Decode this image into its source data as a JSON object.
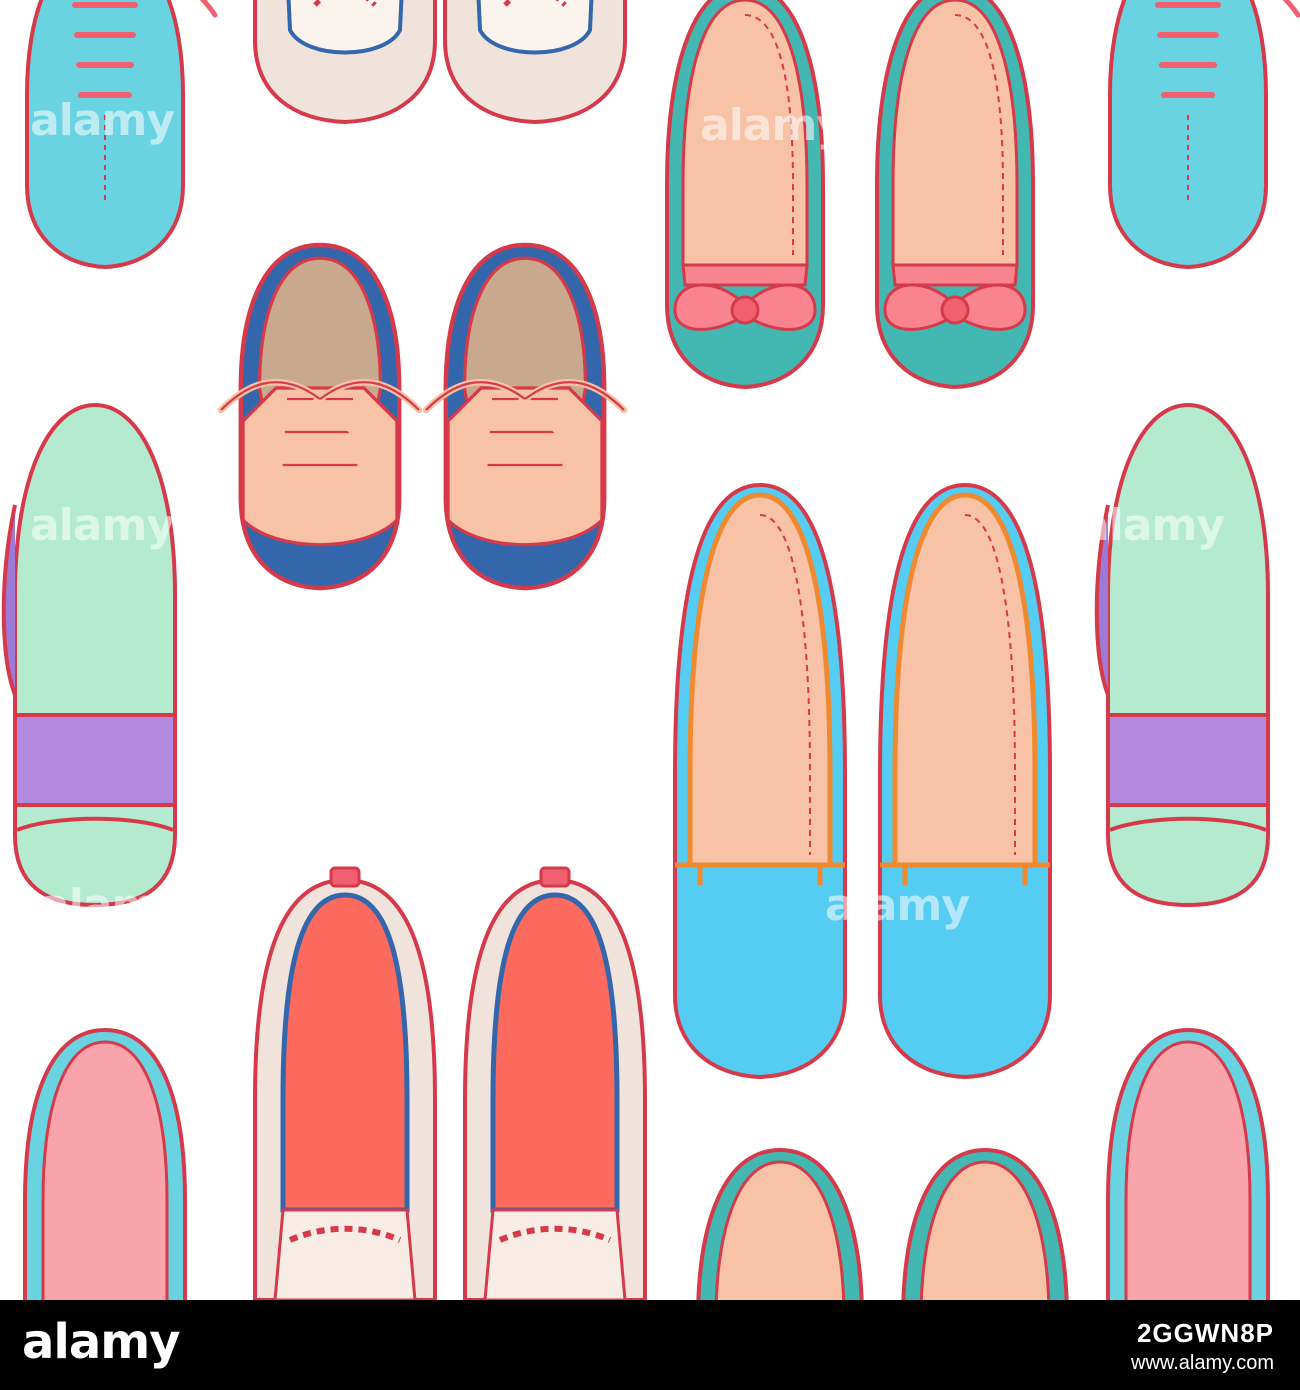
{
  "watermark": "alamy",
  "footer": {
    "brand": "alamy",
    "image_id": "2GGWN8P",
    "site": "www.alamy.com"
  },
  "palette": {
    "outline": "#d63a4a",
    "turquoise": "#6ad3e2",
    "teal": "#43b8b2",
    "navy": "#3366aa",
    "peach": "#f7c2a6",
    "coral": "#fb6a5c",
    "mint": "#b3ead0",
    "lilac": "#b48ae0",
    "sky": "#55ccf2",
    "pink": "#f9848f"
  },
  "icons": [
    "oxford-shoe-icon",
    "ballet-flat-icon",
    "loafer-icon",
    "sandal-icon",
    "moccasin-icon"
  ]
}
